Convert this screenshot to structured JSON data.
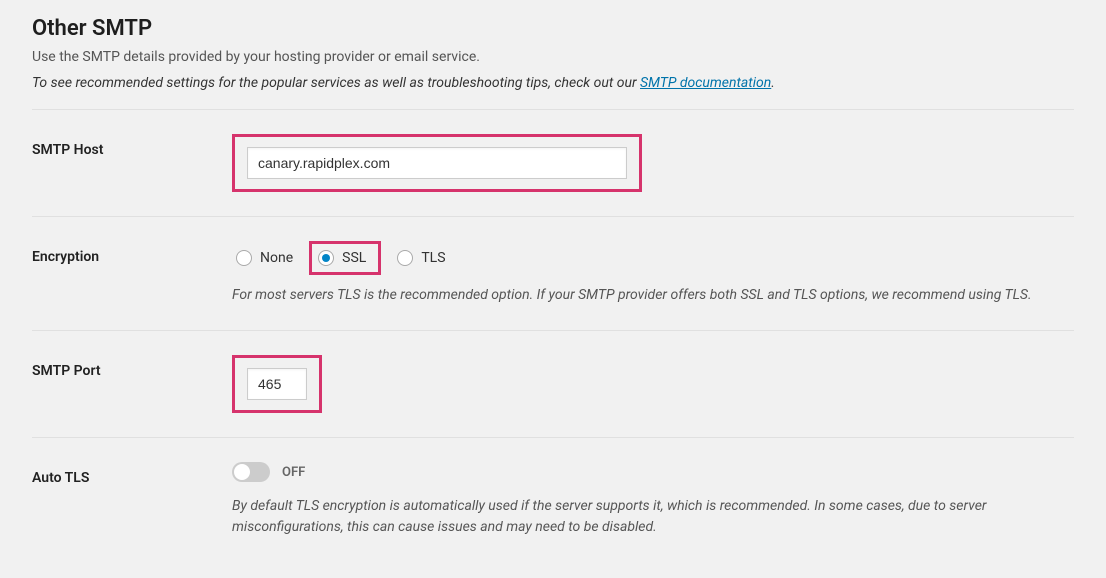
{
  "section": {
    "title": "Other SMTP",
    "description": "Use the SMTP details provided by your hosting provider or email service.",
    "note_prefix": "To see recommended settings for the popular services as well as troubleshooting tips, check out our ",
    "note_link": "SMTP documentation",
    "note_suffix": "."
  },
  "fields": {
    "smtp_host": {
      "label": "SMTP Host",
      "value": "canary.rapidplex.com"
    },
    "encryption": {
      "label": "Encryption",
      "options": {
        "none": "None",
        "ssl": "SSL",
        "tls": "TLS"
      },
      "selected": "ssl",
      "help": "For most servers TLS is the recommended option. If your SMTP provider offers both SSL and TLS options, we recommend using TLS."
    },
    "smtp_port": {
      "label": "SMTP Port",
      "value": "465"
    },
    "auto_tls": {
      "label": "Auto TLS",
      "state": "OFF",
      "help": "By default TLS encryption is automatically used if the server supports it, which is recommended. In some cases, due to server misconfigurations, this can cause issues and may need to be disabled."
    }
  }
}
